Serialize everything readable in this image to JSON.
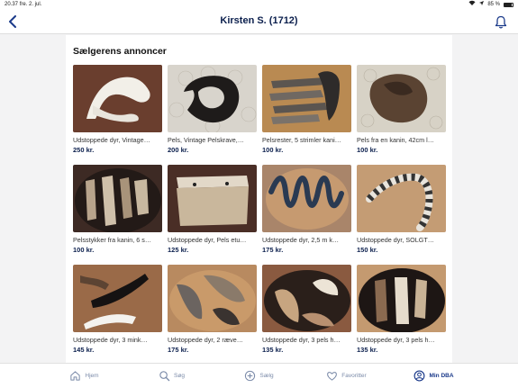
{
  "status": {
    "time": "20.37",
    "date": "fre. 2. jul.",
    "battery": "85 %",
    "battery_level": 0.85
  },
  "header": {
    "title": "Kirsten S. (1712)"
  },
  "section": {
    "title": "Sælgerens annoncer"
  },
  "listings": [
    {
      "title": "Udstoppede dyr, Vintage…",
      "price": "250 kr."
    },
    {
      "title": "Pels, Vintage Pelskrave,…",
      "price": "200 kr."
    },
    {
      "title": "Pelsrester, 5 strimler kani…",
      "price": "100 kr."
    },
    {
      "title": "Pels fra en kanin, 42cm l…",
      "price": "100 kr."
    },
    {
      "title": "Pelsstykker fra kanin, 6 s…",
      "price": "100 kr."
    },
    {
      "title": "Udstoppede dyr, Pels etu…",
      "price": "125 kr."
    },
    {
      "title": "Udstoppede dyr, 2,5 m k…",
      "price": "175 kr."
    },
    {
      "title": "Udstoppede dyr, SOLGT…",
      "price": "150 kr."
    },
    {
      "title": "Udstoppede dyr, 3 mink…",
      "price": "145 kr."
    },
    {
      "title": "Udstoppede dyr, 2 ræve…",
      "price": "175 kr."
    },
    {
      "title": "Udstoppede dyr, 3 pels h…",
      "price": "135 kr."
    },
    {
      "title": "Udstoppede dyr, 3 pels h…",
      "price": "135 kr."
    }
  ],
  "tabs": [
    {
      "label": "Hjem",
      "icon": "home-icon"
    },
    {
      "label": "Søg",
      "icon": "search-icon"
    },
    {
      "label": "Sælg",
      "icon": "sell-icon"
    },
    {
      "label": "Favoritter",
      "icon": "heart-icon"
    },
    {
      "label": "Min DBA",
      "icon": "profile-icon"
    }
  ],
  "colors": {
    "brand": "#0b1f4d",
    "accent": "#1b3a8a",
    "inactive": "#7a8aa8"
  }
}
